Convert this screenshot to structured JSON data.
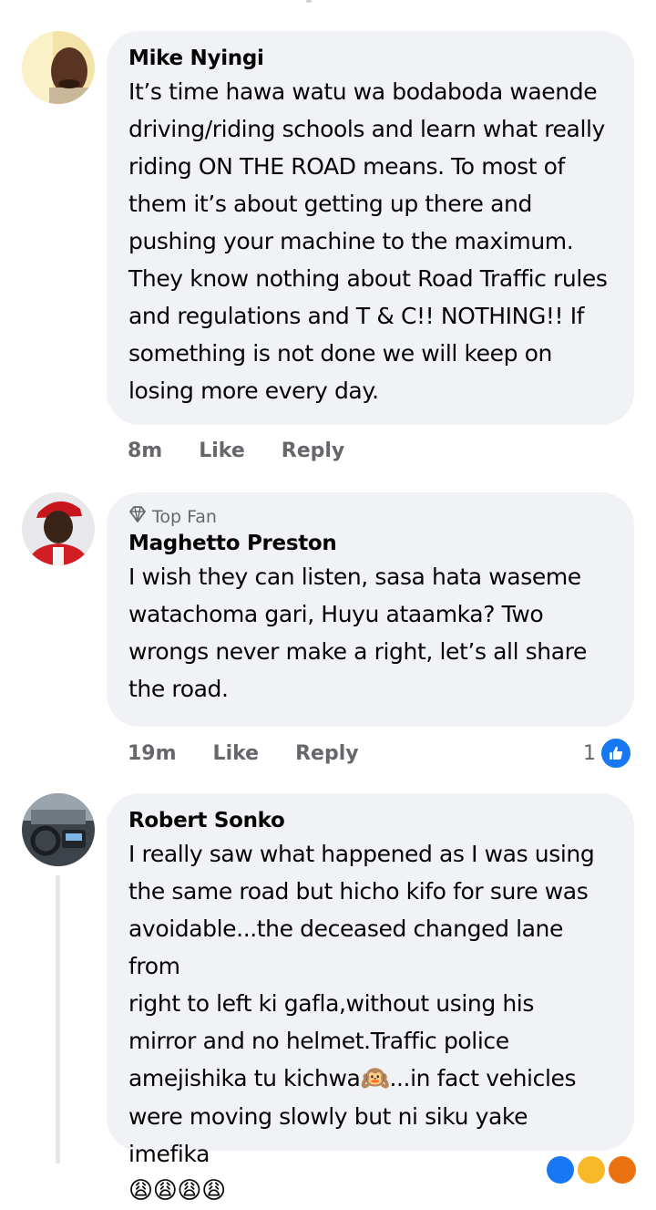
{
  "comments": [
    {
      "author": "Mike Nyingi",
      "text": "It’s time hawa watu wa bodaboda waende\ndriving/riding schools and learn what really\nriding ON THE ROAD means. To most of\nthem it’s about getting up there and\npushing your machine to the maximum.\nThey know nothing about Road Traffic rules\nand regulations and T & C!! NOTHING!! If\nsomething is not done we will keep on\nlosing more every day.",
      "time": "8m",
      "like": "Like",
      "reply": "Reply"
    },
    {
      "badge": "Top Fan",
      "author": "Maghetto Preston",
      "text": "I wish they can listen,  sasa hata waseme\nwatachoma gari, Huyu ataamka? Two\nwrongs never make a right, let’s all share\nthe road.",
      "time": "19m",
      "like": "Like",
      "reply": "Reply",
      "reaction_count": "1"
    },
    {
      "author": "Robert Sonko",
      "text_lines": [
        "I really saw what happened as I was using",
        "the same road but hicho kifo for sure was",
        "avoidable...the deceased changed lane from",
        "right to left ki gafla,without using his",
        "mirror and no helmet.Traffic police"
      ],
      "text_line6_before": "amejishika tu kichwa",
      "text_line6_emoji": "🙉",
      "text_line6_after": "...in fact vehicles",
      "text_line7": "were moving slowly but ni siku yake imefika",
      "text_line8": "😩😩😩😩"
    }
  ],
  "colors": {
    "bubble": "#f0f2f5",
    "secondary_text": "#65676b",
    "like_blue": "#1877f2"
  },
  "icons": {
    "top_fan": "diamond-icon",
    "reaction": "thumbs-up-icon"
  }
}
